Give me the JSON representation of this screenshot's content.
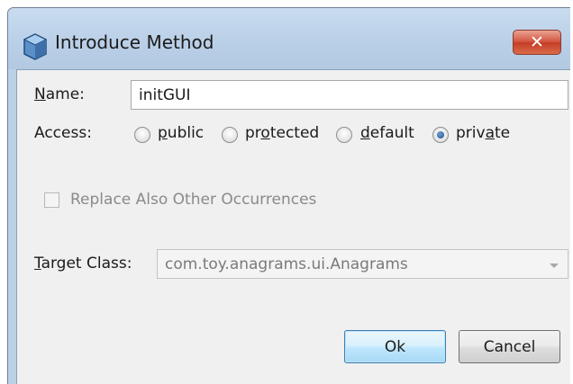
{
  "window": {
    "title": "Introduce Method",
    "icon": "netbeans-cube-icon",
    "close_glyph": "✕"
  },
  "form": {
    "name_label": "Name:",
    "name_value": "initGUI",
    "access_label": "Access:",
    "access_options": [
      {
        "label": "public",
        "checked": false
      },
      {
        "label": "protected",
        "checked": false
      },
      {
        "label": "default",
        "checked": false
      },
      {
        "label": "private",
        "checked": true
      }
    ],
    "replace_label": "Replace Also Other Occurrences",
    "replace_checked": false,
    "replace_enabled": false,
    "target_label": "Target Class:",
    "target_value": "com.toy.anagrams.ui.Anagrams",
    "target_enabled": false
  },
  "buttons": {
    "ok": "Ok",
    "cancel": "Cancel"
  },
  "colors": {
    "titlebar": "#bcd0e6",
    "close_button": "#c43d25",
    "dialog_bg": "#f0f0f0",
    "default_button_border": "#3c7fb1"
  }
}
